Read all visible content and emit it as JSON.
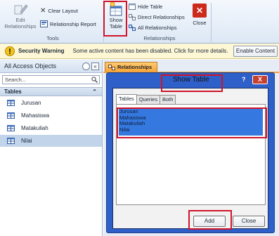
{
  "ribbon": {
    "edit_relationships": "Edit\nRelationships",
    "clear_layout": "Clear Layout",
    "relationship_report": "Relationship Report",
    "tools_group": "Tools",
    "show_table": "Show\nTable",
    "hide_table": "Hide Table",
    "direct_relationships": "Direct Relationships",
    "all_relationships": "All Relationships",
    "close": "Close",
    "relationships_group": "Relationships"
  },
  "security_warning": {
    "title": "Security Warning",
    "message": "Some active content has been disabled. Click for more details.",
    "enable_button": "Enable Content"
  },
  "nav_pane": {
    "title": "All Access Objects",
    "search_placeholder": "Search...",
    "section": "Tables",
    "items": [
      "Jurusan",
      "Mahasiswa",
      "Matakuliah",
      "Nilai"
    ],
    "selected_item": "Nilai"
  },
  "document_tab": {
    "label": "Relationships"
  },
  "dialog": {
    "title": "Show Table",
    "help": "?",
    "close": "X",
    "tabs": [
      "Tables",
      "Queries",
      "Both"
    ],
    "active_tab": "Tables",
    "tables": [
      "Jurusan",
      "Mahasiswa",
      "Matakuliah",
      "Nilai"
    ],
    "add_button": "Add",
    "close_button": "Close"
  },
  "colors": {
    "callout": "#d0142a",
    "dialog_frame": "#2f5fc8",
    "selection": "#3579e0",
    "doc_tab": "#f5a53a"
  }
}
